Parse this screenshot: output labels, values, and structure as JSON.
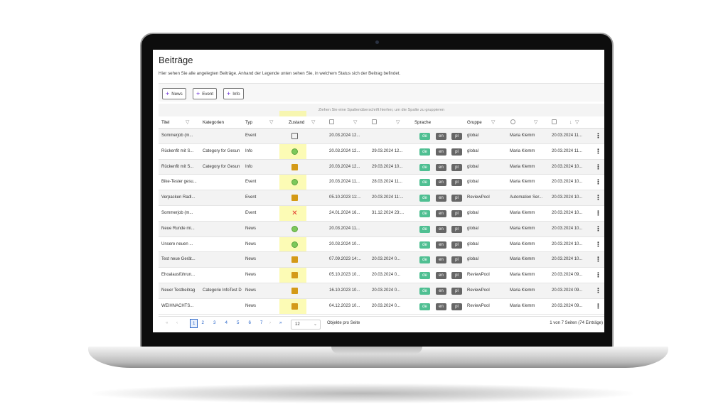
{
  "page": {
    "title": "Beiträge",
    "description": "Hier sehen Sie alle angelegten Beiträge. Anhand der Legende unten sehen Sie, in welchem Status sich der Beitrag befindet."
  },
  "toolbar": {
    "buttons": [
      {
        "label": "News"
      },
      {
        "label": "Event"
      },
      {
        "label": "Info"
      }
    ]
  },
  "group_hint": "Ziehen Sie eine Spaltenüberschrift hierher, um die Spalte zu gruppieren",
  "columns": {
    "titel": "Titel",
    "kategorien": "Kategorien",
    "typ": "Typ",
    "zustand": "Zustand",
    "sprache": "Sprache",
    "gruppe": "Gruppe"
  },
  "filter_glyph": "▽",
  "lang_labels": {
    "de": "de",
    "en": "en",
    "pl": "pl"
  },
  "kebab": "⋮",
  "rows": [
    {
      "titel": "Sommerjob (m...",
      "kategorie": "",
      "typ": "Event",
      "zustand": "edit",
      "d1": "20.03.2024 12...",
      "d2": "",
      "gruppe": "global",
      "user": "Maria Klemm",
      "d3": "20.03.2024 11..."
    },
    {
      "titel": "Rückenfit mit S...",
      "kategorie": "Category for Gesun",
      "typ": "Info",
      "zustand": "green",
      "d1": "20.03.2024 12...",
      "d2": "29.03.2024 12...",
      "gruppe": "global",
      "user": "Maria Klemm",
      "d3": "20.03.2024 11..."
    },
    {
      "titel": "Rückenfit mit S...",
      "kategorie": "Category for Gesun",
      "typ": "Info",
      "zustand": "box",
      "d1": "20.03.2024 12...",
      "d2": "29.03.2024 10...",
      "gruppe": "global",
      "user": "Maria Klemm",
      "d3": "20.03.2024 10..."
    },
    {
      "titel": "Bike-Tester gesu...",
      "kategorie": "",
      "typ": "Event",
      "zustand": "green",
      "d1": "20.03.2024 11...",
      "d2": "28.03.2024 11...",
      "gruppe": "global",
      "user": "Maria Klemm",
      "d3": "20.03.2024 10..."
    },
    {
      "titel": "Verpacken Radl...",
      "kategorie": "",
      "typ": "Event",
      "zustand": "box",
      "d1": "05.10.2023 11:...",
      "d2": "20.03.2024 11:...",
      "gruppe": "ReviewPool",
      "user": "Automation Ser...",
      "d3": "20.03.2024 10..."
    },
    {
      "titel": "Sommerjob (m...",
      "kategorie": "",
      "typ": "Event",
      "zustand": "x",
      "d1": "24.01.2024 16...",
      "d2": "31.12.2024 23:...",
      "gruppe": "global",
      "user": "Maria Klemm",
      "d3": "20.03.2024 10..."
    },
    {
      "titel": "Neue Runde mi...",
      "kategorie": "",
      "typ": "News",
      "zustand": "green",
      "d1": "20.03.2024 11...",
      "d2": "",
      "gruppe": "global",
      "user": "Maria Klemm",
      "d3": "20.03.2024 10..."
    },
    {
      "titel": "Unsere neuen ...",
      "kategorie": "",
      "typ": "News",
      "zustand": "green",
      "d1": "20.03.2024 10...",
      "d2": "",
      "gruppe": "global",
      "user": "Maria Klemm",
      "d3": "20.03.2024 10..."
    },
    {
      "titel": "Test neue Gerät...",
      "kategorie": "",
      "typ": "News",
      "zustand": "box",
      "d1": "07.09.2023 14:...",
      "d2": "20.03.2024 0...",
      "gruppe": "global",
      "user": "Maria Klemm",
      "d3": "20.03.2024 10..."
    },
    {
      "titel": "Ehoalausführun...",
      "kategorie": "",
      "typ": "News",
      "zustand": "box",
      "d1": "05.10.2023 10...",
      "d2": "20.03.2024 0...",
      "gruppe": "ReviewPool",
      "user": "Maria Klemm",
      "d3": "20.03.2024 09..."
    },
    {
      "titel": "Neuer Testbeitrag",
      "kategorie": "Categorie InfoTest D",
      "typ": "News",
      "zustand": "box",
      "d1": "16.10.2023 10...",
      "d2": "20.03.2024 0...",
      "gruppe": "ReviewPool",
      "user": "Maria Klemm",
      "d3": "20.03.2024 09..."
    },
    {
      "titel": "WEIHNACHTS...",
      "kategorie": "",
      "typ": "News",
      "zustand": "box",
      "d1": "04.12.2023 10...",
      "d2": "20.03.2024 0...",
      "gruppe": "ReviewPool",
      "user": "Maria Klemm",
      "d3": "20.03.2024 09..."
    }
  ],
  "pager": {
    "first": "«",
    "prev": "‹",
    "pages": [
      "1",
      "2",
      "3",
      "4",
      "5",
      "6",
      "7"
    ],
    "active": "1",
    "next": "›",
    "last": "»",
    "page_size": "12",
    "page_size_label": "Objekte pro Seite",
    "info": "1 von 7 Seiten (74 Einträge)"
  },
  "colors": {
    "accent_purple": "#6b2fd6",
    "lang_active": "#4fbf92",
    "lang_inactive": "#666666",
    "status_green": "#7cc85a",
    "status_box": "#d49a17",
    "status_x": "#e2362b",
    "highlight": "#faf878"
  }
}
